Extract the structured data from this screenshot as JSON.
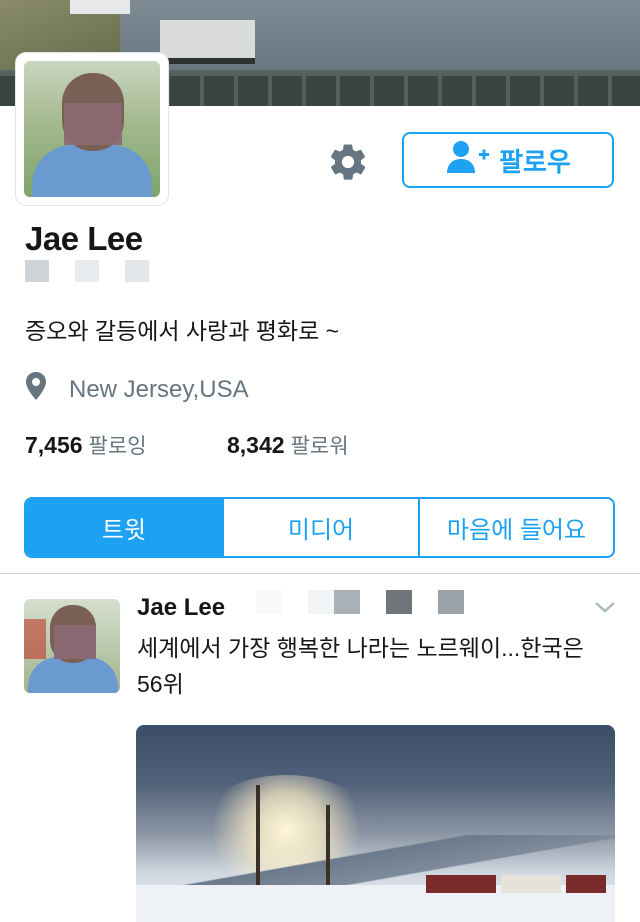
{
  "profile": {
    "name": "Jae Lee",
    "bio": "증오와 갈등에서 사랑과 평화로 ~",
    "location": "New Jersey,USA",
    "following_count": "7,456",
    "following_label": "팔로잉",
    "followers_count": "8,342",
    "followers_label": "팔로워"
  },
  "actions": {
    "follow_label": "팔로우",
    "settings_icon": "gear-icon",
    "follow_icon": "add-user-icon"
  },
  "tabs": [
    {
      "label": "트윗",
      "active": true
    },
    {
      "label": "미디어",
      "active": false
    },
    {
      "label": "마음에 들어요",
      "active": false
    }
  ],
  "tweet": {
    "author": "Jae Lee",
    "text": "세계에서 가장 행복한 나라는 노르웨이...한국은 56위",
    "menu_icon": "chevron-down-icon"
  },
  "colors": {
    "accent": "#1da1f2",
    "secondary_text": "#66757f",
    "primary_text": "#14171a"
  }
}
